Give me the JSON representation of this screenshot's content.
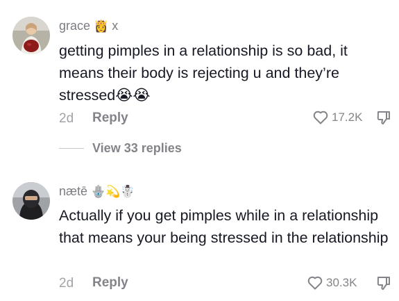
{
  "comments": [
    {
      "username": "grace",
      "username_emoji": "👸",
      "username_suffix": "x",
      "text": "getting pimples in a relationship is so bad, it means their body is rejecting u and they’re stressed😭😭",
      "age": "2d",
      "reply_label": "Reply",
      "likes": "17.2K",
      "view_replies": "View 33 replies"
    },
    {
      "username": "nætē",
      "username_emoji": "🪬💫☃️",
      "text": "Actually if you get pimples while in a relationship that means your being stressed in the relationship",
      "age": "2d",
      "reply_label": "Reply",
      "likes": "30.3K"
    }
  ],
  "colors": {
    "text": "#161823",
    "muted": "#838489",
    "username": "#7b7c82"
  },
  "icons": [
    "heart-icon",
    "dislike-icon"
  ]
}
